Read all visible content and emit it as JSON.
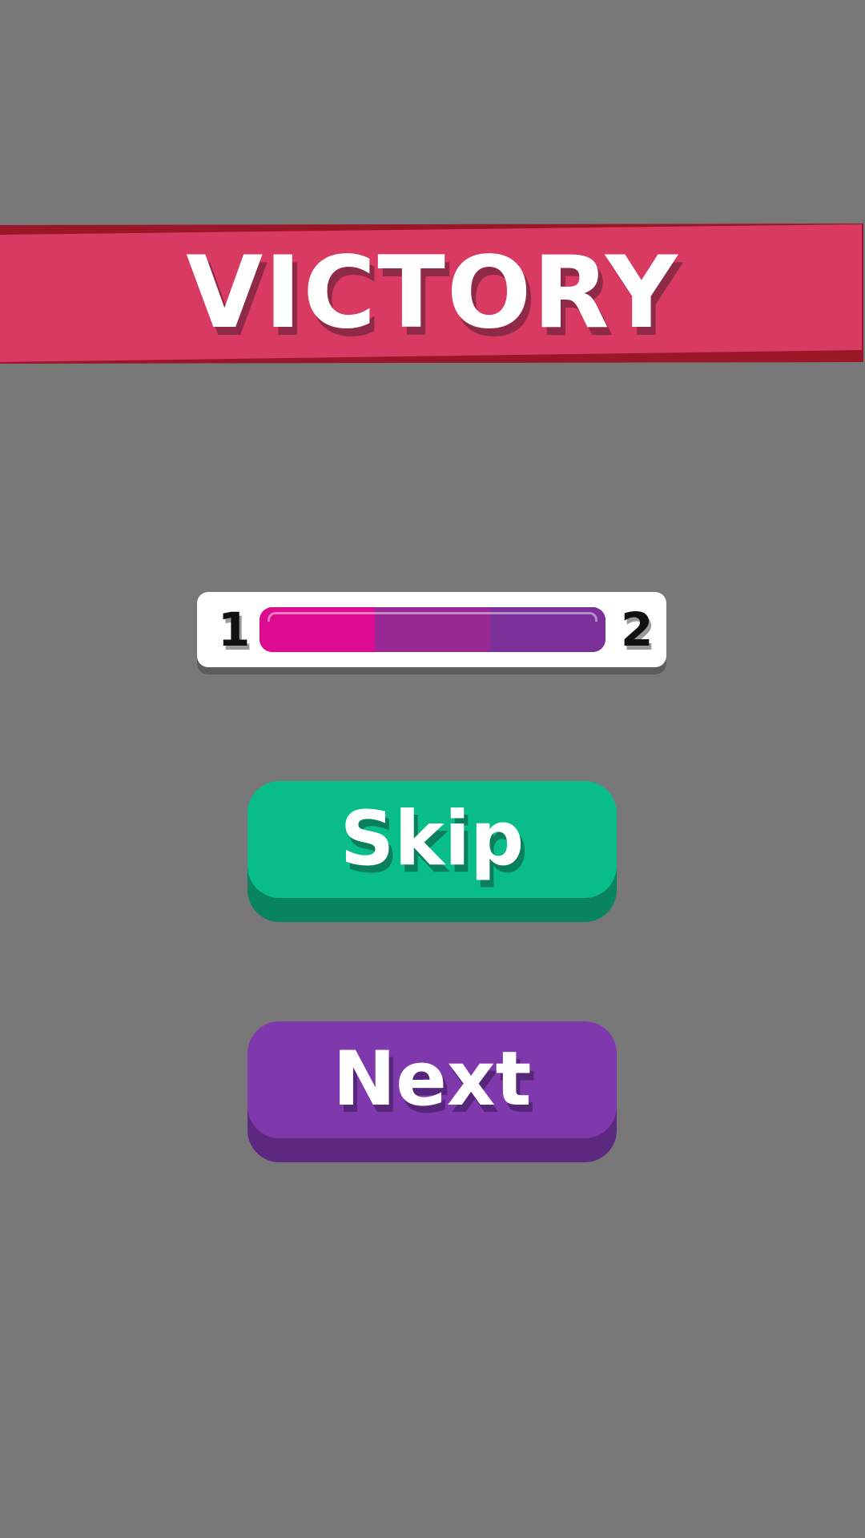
{
  "banner": {
    "title": "VICTORY",
    "color": "#d83a62",
    "shadow_color": "#9a1727"
  },
  "progress": {
    "current_level": "1",
    "next_level": "2",
    "segments_total": 3,
    "segments_filled": 3,
    "segment_colors": [
      "#dd0b8f",
      "#9a2894",
      "#7a3098"
    ]
  },
  "buttons": {
    "skip": {
      "label": "Skip",
      "color": "#08bd8a"
    },
    "next": {
      "label": "Next",
      "color": "#7f39ad"
    }
  },
  "background_color": "#787878"
}
